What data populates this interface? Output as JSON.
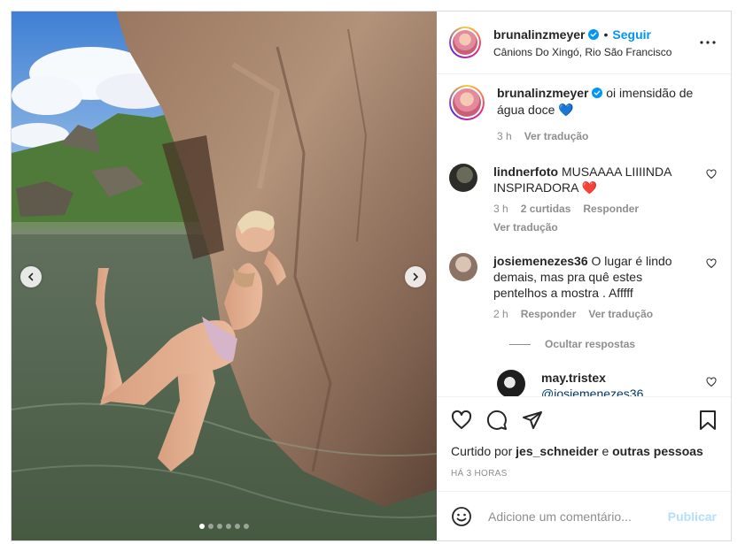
{
  "post": {
    "author": {
      "username": "brunalinzmeyer",
      "verified": true,
      "follow_label": "Seguir",
      "separator": "•",
      "location": "Cânions Do Xingó, Rio São Francisco"
    },
    "caption": {
      "username": "brunalinzmeyer",
      "text": "oi imensidão de água doce",
      "emoji": "💙",
      "time": "3 h",
      "translate_label": "Ver tradução"
    },
    "comments": [
      {
        "username": "lindnerfoto",
        "text": "MUSAAAA LIIIINDA INSPIRADORA",
        "emoji": "❤️",
        "time": "3 h",
        "likes_label": "2 curtidas",
        "reply_label": "Responder",
        "translate_label": "Ver tradução"
      },
      {
        "username": "josiemenezes36",
        "text": "O lugar é lindo demais, mas pra quê estes pentelhos a mostra . Afffff",
        "time": "2 h",
        "reply_label": "Responder",
        "translate_label": "Ver tradução",
        "hide_replies_label": "Ocultar respostas"
      },
      {
        "username": "may.tristex",
        "text": "@josiemenezes36"
      }
    ],
    "likes": {
      "prefix": "Curtido por",
      "user": "jes_schneider",
      "connector": "e",
      "others": "outras pessoas"
    },
    "posted_time": "HÁ 3 HORAS",
    "add_comment": {
      "placeholder": "Adicione um comentário...",
      "publish_label": "Publicar"
    },
    "carousel": {
      "total": 6,
      "active_index": 0
    },
    "icons": {
      "verified": "verified-badge-icon",
      "more": "more-options-icon",
      "like": "heart-icon",
      "comment": "comment-bubble-icon",
      "share": "paper-plane-icon",
      "save": "bookmark-icon",
      "emoji": "emoji-smiley-icon",
      "prev": "chevron-left-icon",
      "next": "chevron-right-icon"
    },
    "colors": {
      "accent": "#0095f6",
      "publish_disabled": "#b2dffc",
      "muted": "#8e8e8e",
      "text": "#262626"
    }
  }
}
